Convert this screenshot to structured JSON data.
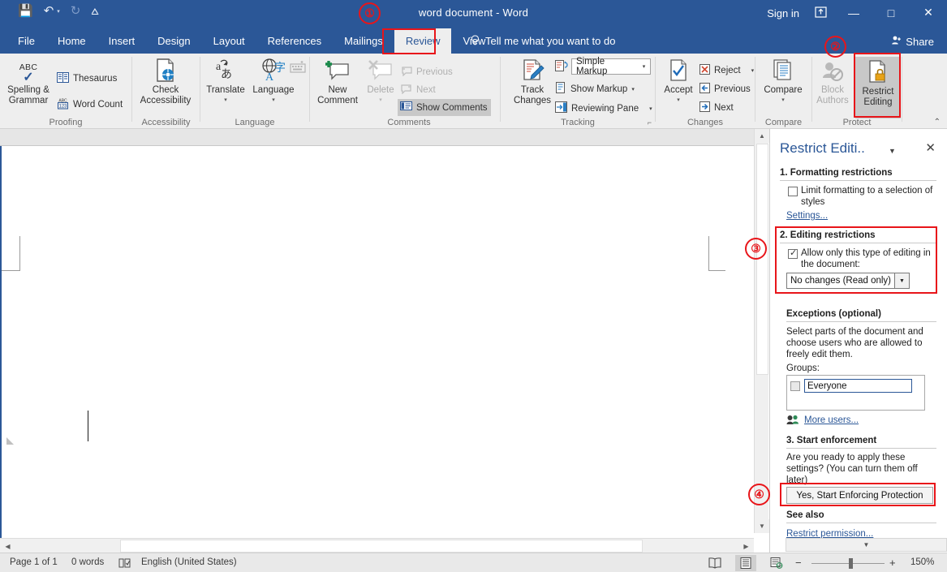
{
  "titlebar": {
    "document_title": "word document  -  Word",
    "quick_access": [
      {
        "name": "save-icon",
        "glyph": "💾"
      },
      {
        "name": "undo-icon",
        "glyph": "↶"
      },
      {
        "name": "redo-icon",
        "glyph": "↻"
      },
      {
        "name": "customize-qat-icon",
        "glyph": "⩟"
      }
    ],
    "sign_in": "Sign in",
    "ribbon_display_options": "⤒",
    "minimize": "—",
    "maximize": "□",
    "close": "✕"
  },
  "tabs": [
    {
      "label": "File",
      "active": false
    },
    {
      "label": "Home",
      "active": false
    },
    {
      "label": "Insert",
      "active": false
    },
    {
      "label": "Design",
      "active": false
    },
    {
      "label": "Layout",
      "active": false
    },
    {
      "label": "References",
      "active": false
    },
    {
      "label": "Mailings",
      "active": false
    },
    {
      "label": "Review",
      "active": true
    },
    {
      "label": "View",
      "active": false
    }
  ],
  "tellme": {
    "placeholder": "Tell me what you want to do",
    "icon": "💡"
  },
  "share": {
    "label": "Share",
    "icon": "👤"
  },
  "ribbon": {
    "groups": [
      {
        "name": "proofing",
        "label": "Proofing"
      },
      {
        "name": "accessibility",
        "label": "Accessibility"
      },
      {
        "name": "language",
        "label": "Language"
      },
      {
        "name": "comments",
        "label": "Comments"
      },
      {
        "name": "tracking",
        "label": "Tracking"
      },
      {
        "name": "changes",
        "label": "Changes"
      },
      {
        "name": "compare",
        "label": "Compare"
      },
      {
        "name": "protect",
        "label": "Protect"
      }
    ],
    "proofing": {
      "spelling_line1": "Spelling &",
      "spelling_line2": "Grammar",
      "abc_mark": "ABC",
      "thesaurus": "Thesaurus",
      "word_count": "Word Count"
    },
    "accessibility": {
      "check_line1": "Check",
      "check_line2": "Accessibility"
    },
    "language": {
      "translate": "Translate",
      "language": "Language"
    },
    "comments": {
      "new_line1": "New",
      "new_line2": "Comment",
      "delete": "Delete",
      "previous": "Previous",
      "next": "Next",
      "show_comments": "Show Comments"
    },
    "tracking": {
      "track_line1": "Track",
      "track_line2": "Changes",
      "markup_mode": "Simple Markup",
      "show_markup": "Show Markup",
      "reviewing_pane": "Reviewing Pane"
    },
    "changes": {
      "accept": "Accept",
      "reject": "Reject",
      "previous": "Previous",
      "next": "Next"
    },
    "compare": {
      "compare": "Compare"
    },
    "protect": {
      "block_line1": "Block",
      "block_line2": "Authors",
      "restrict_line1": "Restrict",
      "restrict_line2": "Editing"
    },
    "collapse_icon": "⌃"
  },
  "pane": {
    "title": "Restrict Editi..",
    "caret": "▼",
    "close": "✕",
    "section1_heading": "1. Formatting restrictions",
    "limit_formatting_line1": "Limit formatting to a selection",
    "limit_formatting_line2": "of styles",
    "settings_link": "Settings...",
    "section2_heading": "2. Editing restrictions",
    "allow_only_line1": "Allow only this type of editing",
    "allow_only_line2": "in the document:",
    "editing_mode": "No changes (Read only)",
    "exceptions_heading": "Exceptions (optional)",
    "exceptions_line1": "Select parts of the document and",
    "exceptions_line2": "choose users who are allowed to",
    "exceptions_line3": "freely edit them.",
    "groups_label": "Groups:",
    "group_everyone": "Everyone",
    "more_users": "More users...",
    "section3_heading": "3. Start enforcement",
    "enforce_line1": "Are you ready to apply these",
    "enforce_line2": "settings? (You can turn them off",
    "enforce_line3": "later)",
    "enforce_button": "Yes, Start Enforcing Protection",
    "see_also_heading": "See also",
    "restrict_permission_link": "Restrict permission..."
  },
  "statusbar": {
    "page": "Page 1 of 1",
    "words": "0 words",
    "proofing_icon": "📖",
    "language": "English (United States)",
    "views": [
      {
        "name": "read-mode-view-button",
        "glyph": "📖",
        "active": false
      },
      {
        "name": "print-layout-view-button",
        "glyph": "▤",
        "active": true
      },
      {
        "name": "web-layout-view-button",
        "glyph": "🗒",
        "active": false
      }
    ],
    "zoom_out": "−",
    "zoom_in": "+",
    "zoom_level": "150%"
  },
  "annotations": [
    {
      "number": "①",
      "target": "review-tab"
    },
    {
      "number": "②",
      "target": "restrict-editing-button"
    },
    {
      "number": "③",
      "target": "editing-restrictions-section"
    },
    {
      "number": "④",
      "target": "start-enforcing-protection-button"
    }
  ],
  "colors": {
    "word_blue": "#2b5797",
    "ribbon_bg": "#eeeeee",
    "annotation_red": "#e8151a",
    "link_blue": "#2b5797"
  }
}
